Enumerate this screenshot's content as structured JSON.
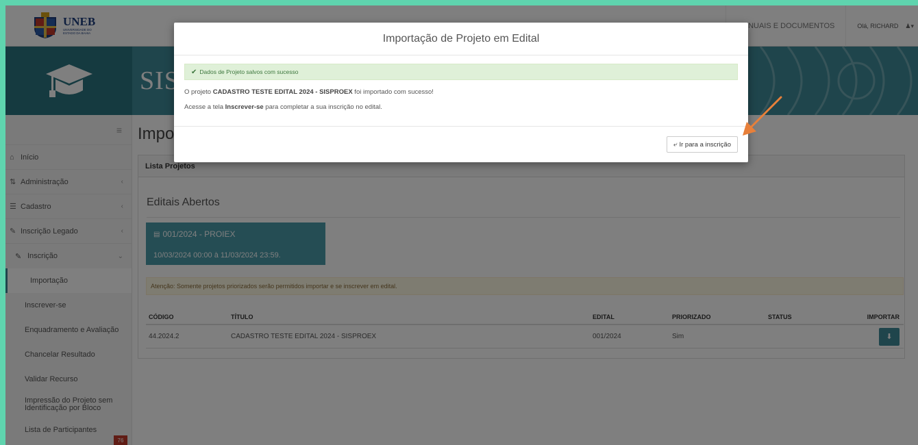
{
  "header": {
    "logo_name": "UNEB",
    "logo_sub_1": "Universidade do",
    "logo_sub_2": "Estado da Bahia",
    "manuals_link": "MANUAIS E DOCUMENTOS",
    "user_greeting": "Olá, RICHARD"
  },
  "banner": {
    "title": "SISPROEX"
  },
  "sidebar": {
    "items": [
      {
        "label": "Início",
        "icon": "home-icon"
      },
      {
        "label": "Administração",
        "icon": "admin-icon"
      },
      {
        "label": "Cadastro",
        "icon": "list-icon"
      },
      {
        "label": "Inscrição Legado",
        "icon": "edit-icon"
      },
      {
        "label": "Inscrição",
        "icon": "edit-icon"
      }
    ],
    "subitems": [
      "Importação",
      "Inscrever-se",
      "Enquadramento e Avaliação",
      "Chancelar Resultado",
      "Validar Recurso",
      "Impressão do Projeto sem Identificação por Bloco",
      "Lista de Participantes"
    ],
    "badge": "76"
  },
  "main": {
    "page_title": "Importação",
    "panel_title": "Lista Projetos",
    "section_title": "Editais Abertos",
    "edital_code": "001/2024 - PROIEX",
    "edital_dates": "10/03/2024 00:00 à 11/03/2024 23:59.",
    "warning": "Atenção: Somente projetos priorizados serão permitidos importar e se inscrever em edital.",
    "table": {
      "headers": [
        "CÓDIGO",
        "TÍTULO",
        "EDITAL",
        "PRIORIZADO",
        "STATUS",
        "IMPORTAR"
      ],
      "rows": [
        {
          "codigo": "44.2024.2",
          "titulo": "CADASTRO TESTE EDITAL 2024 - SISPROEX",
          "edital": "001/2024",
          "priorizado": "Sim",
          "status": ""
        }
      ]
    }
  },
  "modal": {
    "title": "Importação de Projeto em Edital",
    "success": "Dados de Projeto salvos com sucesso",
    "msg1_pre": "O projeto ",
    "msg1_bold": "CADASTRO TESTE EDITAL 2024 - SISPROEX",
    "msg1_post": " foi importado com sucesso!",
    "msg2_pre": "Acesse a tela ",
    "msg2_bold": "Inscrever-se",
    "msg2_post": " para completar a sua inscrição no edital.",
    "button": "Ir para a inscrição"
  },
  "colors": {
    "teal": "#3e8b98",
    "success_bg": "#dff0d8",
    "arrow": "#e8803a"
  }
}
